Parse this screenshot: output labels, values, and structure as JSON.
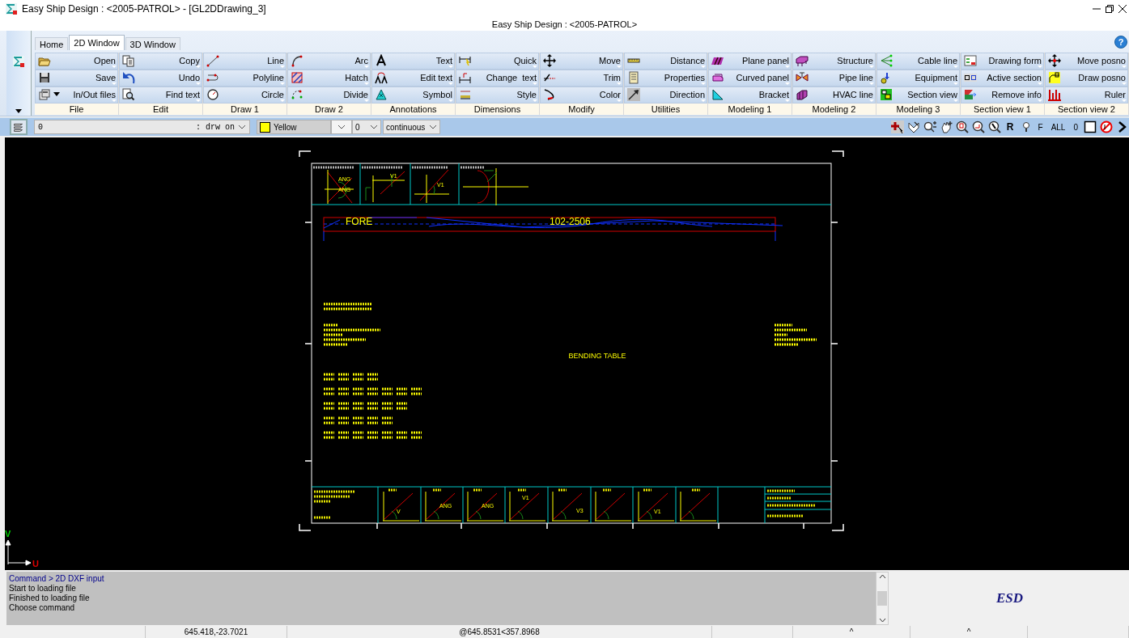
{
  "window": {
    "title": "Easy Ship Design : <2005-PATROL> - [GL2DDrawing_3]",
    "subtitle": "Easy Ship Design : <2005-PATROL>"
  },
  "ribbon": {
    "help": "?",
    "tabs": [
      {
        "label": "Home",
        "selected": false
      },
      {
        "label": "2D Window",
        "selected": true
      },
      {
        "label": "3D Window",
        "selected": false
      }
    ],
    "groups": [
      {
        "label": "File",
        "buttons": [
          "Open",
          "Save",
          "In/Out files"
        ]
      },
      {
        "label": "Edit",
        "buttons": [
          "Copy",
          "Undo",
          "Find text"
        ]
      },
      {
        "label": "Draw 1",
        "buttons": [
          "Line",
          "Polyline",
          "Circle"
        ]
      },
      {
        "label": "Draw 2",
        "buttons": [
          "Arc",
          "Hatch",
          "Divide"
        ]
      },
      {
        "label": "Annotations",
        "buttons": [
          "Text",
          "Edit text",
          "Symbol"
        ]
      },
      {
        "label": "Dimensions",
        "buttons": [
          "Quick",
          "Change  text",
          "Style"
        ]
      },
      {
        "label": "Modify",
        "buttons": [
          "Move",
          "Trim",
          "Color"
        ]
      },
      {
        "label": "Utilities",
        "buttons": [
          "Distance",
          "Properties",
          "Direction"
        ]
      },
      {
        "label": "Modeling 1",
        "buttons": [
          "Plane panel",
          "Curved panel",
          "Bracket"
        ]
      },
      {
        "label": "Modeling 2",
        "buttons": [
          "Structure",
          "Pipe line",
          "HVAC line"
        ]
      },
      {
        "label": "Modeling 3",
        "buttons": [
          "Cable line",
          "Equipment",
          "Section view"
        ]
      },
      {
        "label": "Section view 1",
        "buttons": [
          "Drawing form",
          "Active section",
          "Remove info"
        ]
      },
      {
        "label": "Section view 2",
        "buttons": [
          "Move posno",
          "Draw posno",
          "Ruler"
        ]
      }
    ]
  },
  "toolbar": {
    "layer": {
      "value": "0",
      "state": ": drw on"
    },
    "color": {
      "value": "Yellow"
    },
    "lineweight": {
      "value": "0"
    },
    "linetype": {
      "value": "continuous"
    },
    "labels": [
      "R",
      "F",
      "ALL",
      "0"
    ]
  },
  "drawing": {
    "header_labels": [
      "ANG",
      "ANG",
      "V1",
      "V1"
    ],
    "fore_label": "FORE",
    "profile_label": "102-2506",
    "table_title": "BENDING TABLE",
    "bottom_labels": [
      "V",
      "ANG",
      "ANG",
      "V1",
      "V3",
      "V1"
    ]
  },
  "axis": {
    "v": "V",
    "u": "U"
  },
  "command": {
    "lines": [
      {
        "text": "Command > 2D DXF input",
        "kind": "prompt"
      },
      {
        "text": "Start to loading file",
        "kind": "output"
      },
      {
        "text": "Finished to loading file",
        "kind": "output"
      },
      {
        "text": "Choose command",
        "kind": "output"
      }
    ]
  },
  "brand": "ESD",
  "status_bar": {
    "cells": [
      "645.418,-23.7021",
      "@645.8531<357.8968",
      "^",
      "^"
    ]
  }
}
